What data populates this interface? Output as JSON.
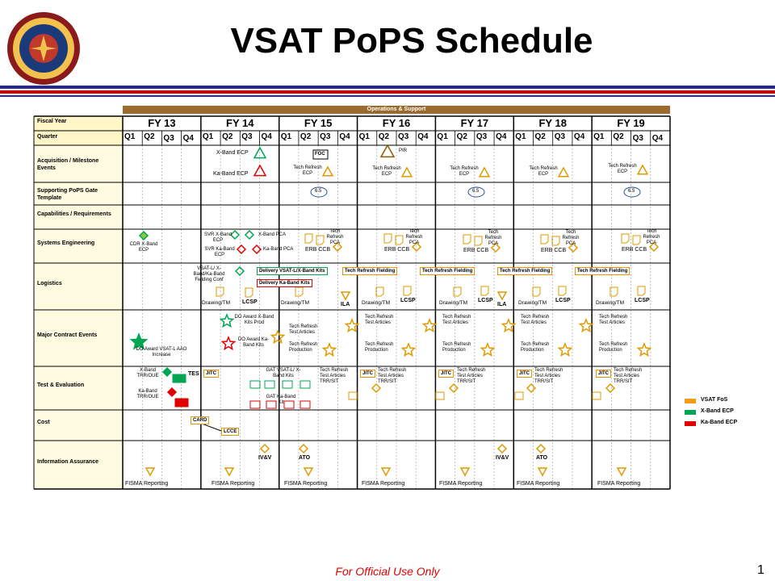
{
  "title": "VSAT PoPS Schedule",
  "footer": "For Official Use Only",
  "page_number": "1",
  "logo_text_top": "MARINE CORPS",
  "logo_text_mid": "ACQUISITION",
  "logo_text_bottom": "SYSTEMS COMMAND",
  "header_bar": "Operations & Support",
  "fiscal_year_label": "Fiscal Year",
  "quarter_label": "Quarter",
  "fiscal_years": [
    "FY 13",
    "FY 14",
    "FY 15",
    "FY 16",
    "FY 17",
    "FY 18",
    "FY 19"
  ],
  "quarters": [
    "Q1",
    "Q2",
    "Q3",
    "Q4"
  ],
  "rows": [
    "Acquisition / Milestone Events",
    "Supporting PoPS Gate Template",
    "Capabilities / Requirements",
    "Systems Engineering",
    "Logistics",
    "Major Contract Events",
    "Test & Evaluation",
    "Cost",
    "Information Assurance"
  ],
  "legend": [
    {
      "label": "VSAT FoS",
      "color": "#f39c12"
    },
    {
      "label": "X-Band ECP",
      "color": "#00a651"
    },
    {
      "label": "Ka-Band ECP",
      "color": "#e00000"
    }
  ],
  "labels": {
    "xband_ecp": "X-Band ECP",
    "kaband_ecp": "Ka-Band ECP",
    "foc": "FOC",
    "pir": "PIR",
    "tech_refresh_ecp": "Tech Refresh ECP",
    "pops_65": "6.5",
    "cdr": "CDR X-Band ECP",
    "svr_x": "SVR X-Band ECP",
    "svr_ka": "SVR Ka-Band ECP",
    "xband_pca": "X-Band PCA",
    "kaband_pca": "Ka-Band PCA",
    "tech_refresh_pca": "Tech Refresh PCA",
    "erb_ccb": "ERB CCB",
    "vsat_fielding_conf": "VSAT-L/ X-Band/Ka-Band Fielding Conf",
    "delivery_x": "Delivery VSAT-L/X-Band Kits",
    "delivery_ka": "Delivery Ka-Band Kits",
    "tech_refresh_fielding": "Tech Refresh Fielding",
    "drawing_tm": "Drawing/TM",
    "lcsp": "LCSP",
    "ila": "ILA",
    "do_award_aao": "DO Award VSAT-L AAO Increase",
    "do_award_x": "DO Award X-Band Kits Prod",
    "do_award_ka": "DO Award Ka-Band Kits",
    "tech_refresh_test_articles": "Tech Refresh Test Articles",
    "tech_refresh_production": "Tech Refresh Production",
    "xband_trr": "X-Band TRR/OUE",
    "kaband_trr": "Ka-Band TRR/OUE",
    "tes": "TES",
    "jitc": "JITC",
    "gat_x": "GAT VSAT-L/ X-Band Kits",
    "gat_ka": "GAT Ka-Band Kit",
    "tech_refresh_trr": "Tech Refresh Test Articles TRR/SIT",
    "card": "CARD",
    "lcce": "LCCE",
    "ivv": "IV&V",
    "ato": "ATO",
    "fisma": "FISMA Reporting"
  }
}
